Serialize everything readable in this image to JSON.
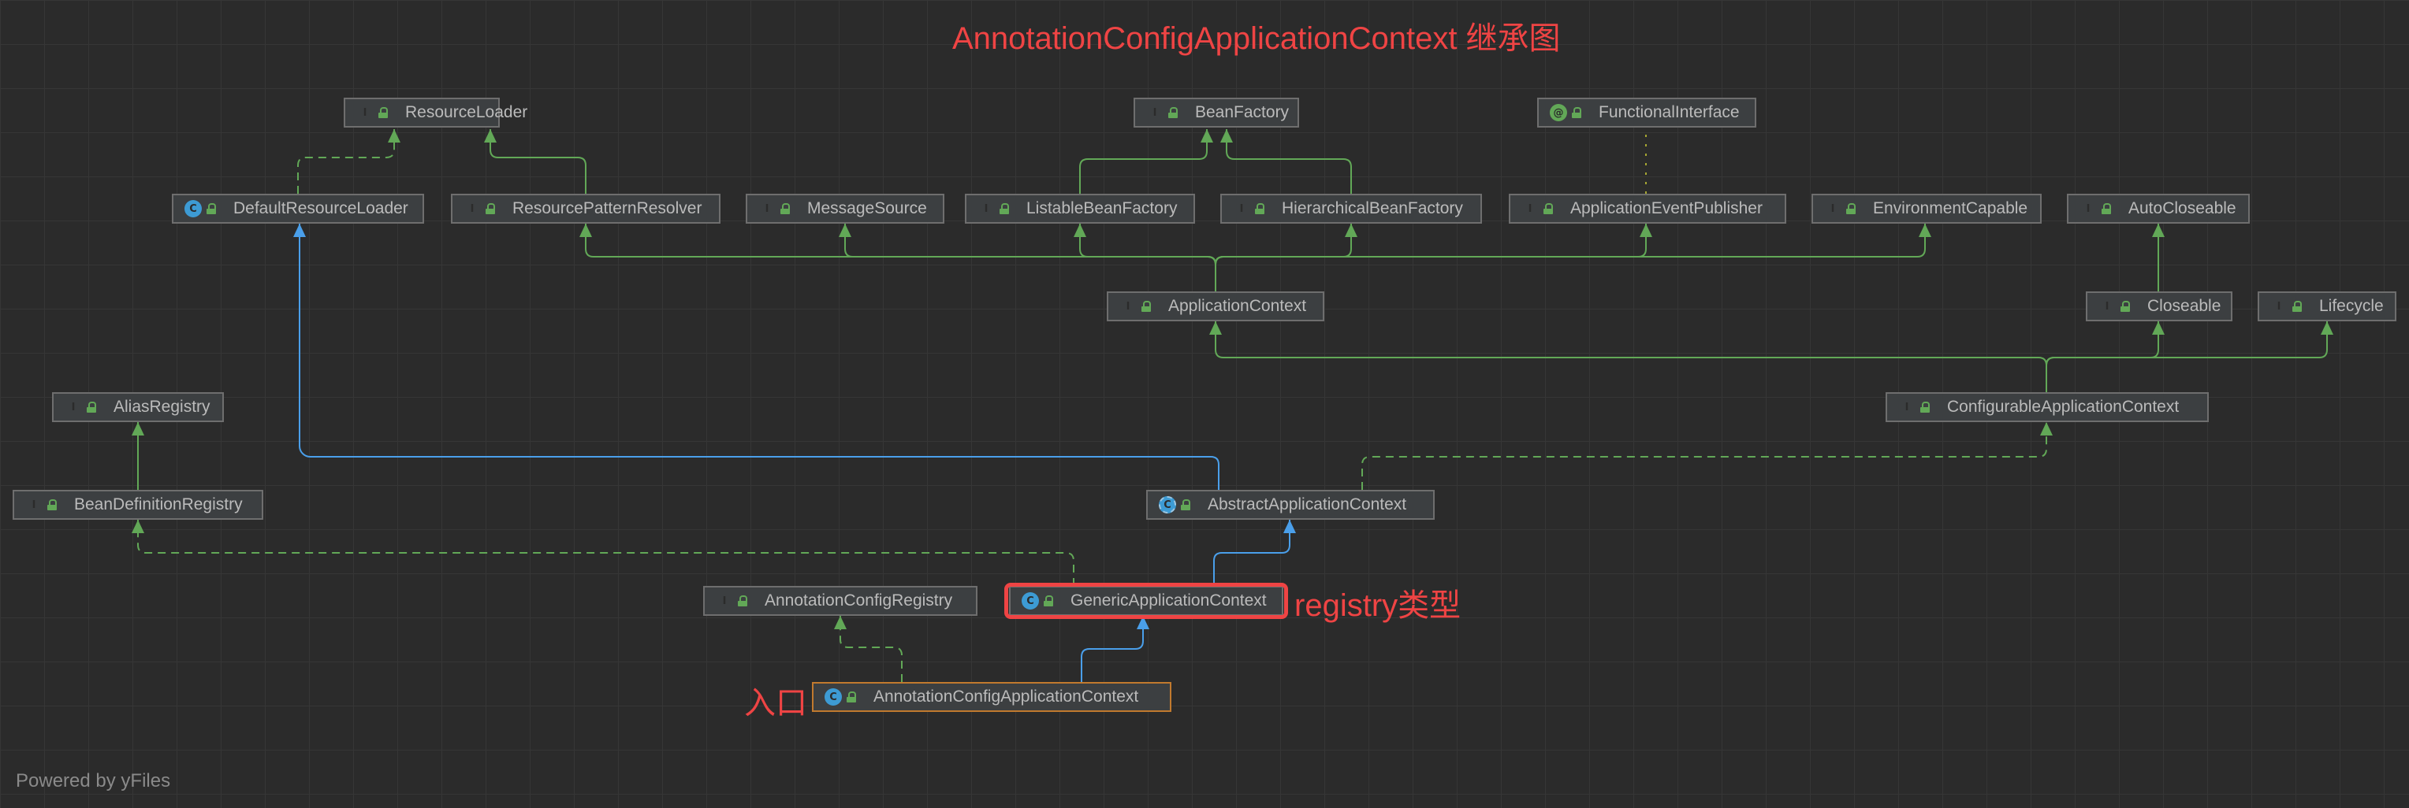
{
  "diagram": {
    "title": "AnnotationConfigApplicationContext 继承图",
    "registry_note": "registry类型",
    "entry_note": "入口",
    "watermark": "Powered by yFiles"
  },
  "colors": {
    "extends_edge": "#62a857",
    "class_extends_edge": "#4a9fea",
    "implements_edge": "#62a857",
    "annotation_edge": "#a7a732",
    "annotation_red": "#ef4444"
  },
  "nodes": {
    "resource_loader": {
      "kind": "interface",
      "label": "ResourceLoader"
    },
    "bean_factory": {
      "kind": "interface",
      "label": "BeanFactory"
    },
    "functional_interface": {
      "kind": "annotation",
      "label": "FunctionalInterface"
    },
    "default_resource_loader": {
      "kind": "class",
      "label": "DefaultResourceLoader"
    },
    "resource_pattern_resolver": {
      "kind": "interface",
      "label": "ResourcePatternResolver"
    },
    "message_source": {
      "kind": "interface",
      "label": "MessageSource"
    },
    "listable_bean_factory": {
      "kind": "interface",
      "label": "ListableBeanFactory"
    },
    "hierarchical_bean_factory": {
      "kind": "interface",
      "label": "HierarchicalBeanFactory"
    },
    "application_event_publisher": {
      "kind": "interface",
      "label": "ApplicationEventPublisher"
    },
    "environment_capable": {
      "kind": "interface",
      "label": "EnvironmentCapable"
    },
    "auto_closeable": {
      "kind": "interface",
      "label": "AutoCloseable"
    },
    "application_context": {
      "kind": "interface",
      "label": "ApplicationContext"
    },
    "closeable": {
      "kind": "interface",
      "label": "Closeable"
    },
    "lifecycle": {
      "kind": "interface",
      "label": "Lifecycle"
    },
    "alias_registry": {
      "kind": "interface",
      "label": "AliasRegistry"
    },
    "configurable_application_context": {
      "kind": "interface",
      "label": "ConfigurableApplicationContext"
    },
    "bean_definition_registry": {
      "kind": "interface",
      "label": "BeanDefinitionRegistry"
    },
    "abstract_application_context": {
      "kind": "abstract",
      "label": "AbstractApplicationContext"
    },
    "annotation_config_registry": {
      "kind": "interface",
      "label": "AnnotationConfigRegistry"
    },
    "generic_application_context": {
      "kind": "class",
      "label": "GenericApplicationContext"
    },
    "annotation_config_application_context": {
      "kind": "class",
      "label": "AnnotationConfigApplicationContext"
    }
  },
  "edges": [
    {
      "from": "default_resource_loader",
      "to": "resource_loader",
      "type": "implements"
    },
    {
      "from": "resource_pattern_resolver",
      "to": "resource_loader",
      "type": "extends"
    },
    {
      "from": "listable_bean_factory",
      "to": "bean_factory",
      "type": "extends"
    },
    {
      "from": "hierarchical_bean_factory",
      "to": "bean_factory",
      "type": "extends"
    },
    {
      "from": "application_event_publisher",
      "to": "functional_interface",
      "type": "annotated"
    },
    {
      "from": "application_context",
      "to": "resource_pattern_resolver",
      "type": "extends"
    },
    {
      "from": "application_context",
      "to": "message_source",
      "type": "extends"
    },
    {
      "from": "application_context",
      "to": "listable_bean_factory",
      "type": "extends"
    },
    {
      "from": "application_context",
      "to": "hierarchical_bean_factory",
      "type": "extends"
    },
    {
      "from": "application_context",
      "to": "application_event_publisher",
      "type": "extends"
    },
    {
      "from": "application_context",
      "to": "environment_capable",
      "type": "extends"
    },
    {
      "from": "closeable",
      "to": "auto_closeable",
      "type": "extends"
    },
    {
      "from": "configurable_application_context",
      "to": "application_context",
      "type": "extends"
    },
    {
      "from": "configurable_application_context",
      "to": "closeable",
      "type": "extends"
    },
    {
      "from": "configurable_application_context",
      "to": "lifecycle",
      "type": "extends"
    },
    {
      "from": "bean_definition_registry",
      "to": "alias_registry",
      "type": "extends"
    },
    {
      "from": "abstract_application_context",
      "to": "default_resource_loader",
      "type": "class-extends"
    },
    {
      "from": "abstract_application_context",
      "to": "configurable_application_context",
      "type": "implements"
    },
    {
      "from": "generic_application_context",
      "to": "abstract_application_context",
      "type": "class-extends"
    },
    {
      "from": "generic_application_context",
      "to": "bean_definition_registry",
      "type": "implements"
    },
    {
      "from": "annotation_config_application_context",
      "to": "generic_application_context",
      "type": "class-extends"
    },
    {
      "from": "annotation_config_application_context",
      "to": "annotation_config_registry",
      "type": "implements"
    }
  ]
}
